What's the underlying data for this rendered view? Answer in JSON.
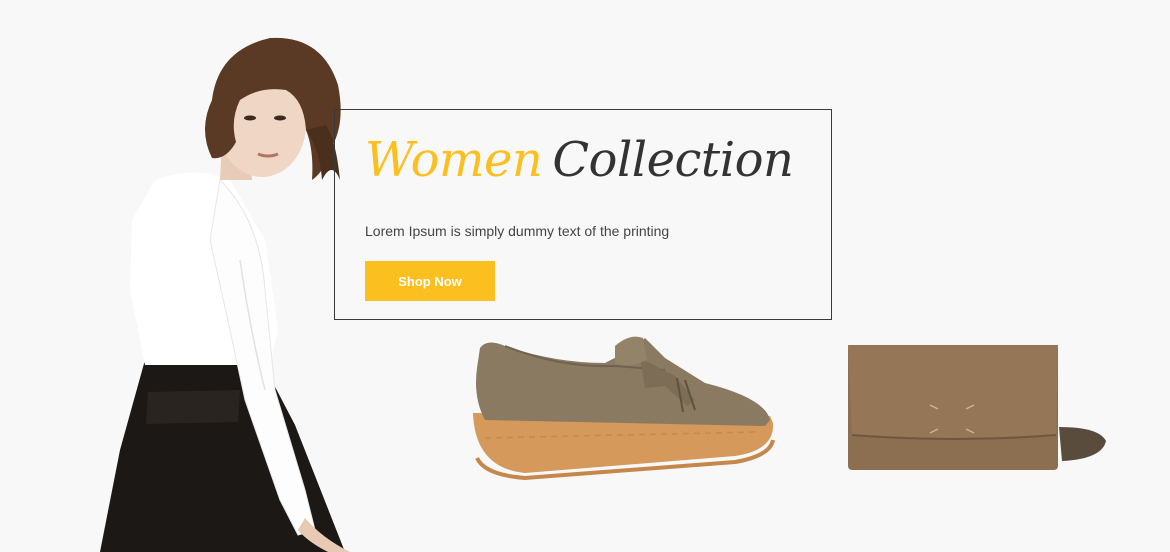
{
  "banner": {
    "headline_accent": "Women",
    "headline_main": "Collection",
    "subtitle": "Lorem Ipsum is simply dummy text of the printing",
    "cta_label": "Shop Now"
  },
  "colors": {
    "accent": "#fbbf1f",
    "headline_dark": "#333333",
    "background": "#f8f8f8"
  }
}
